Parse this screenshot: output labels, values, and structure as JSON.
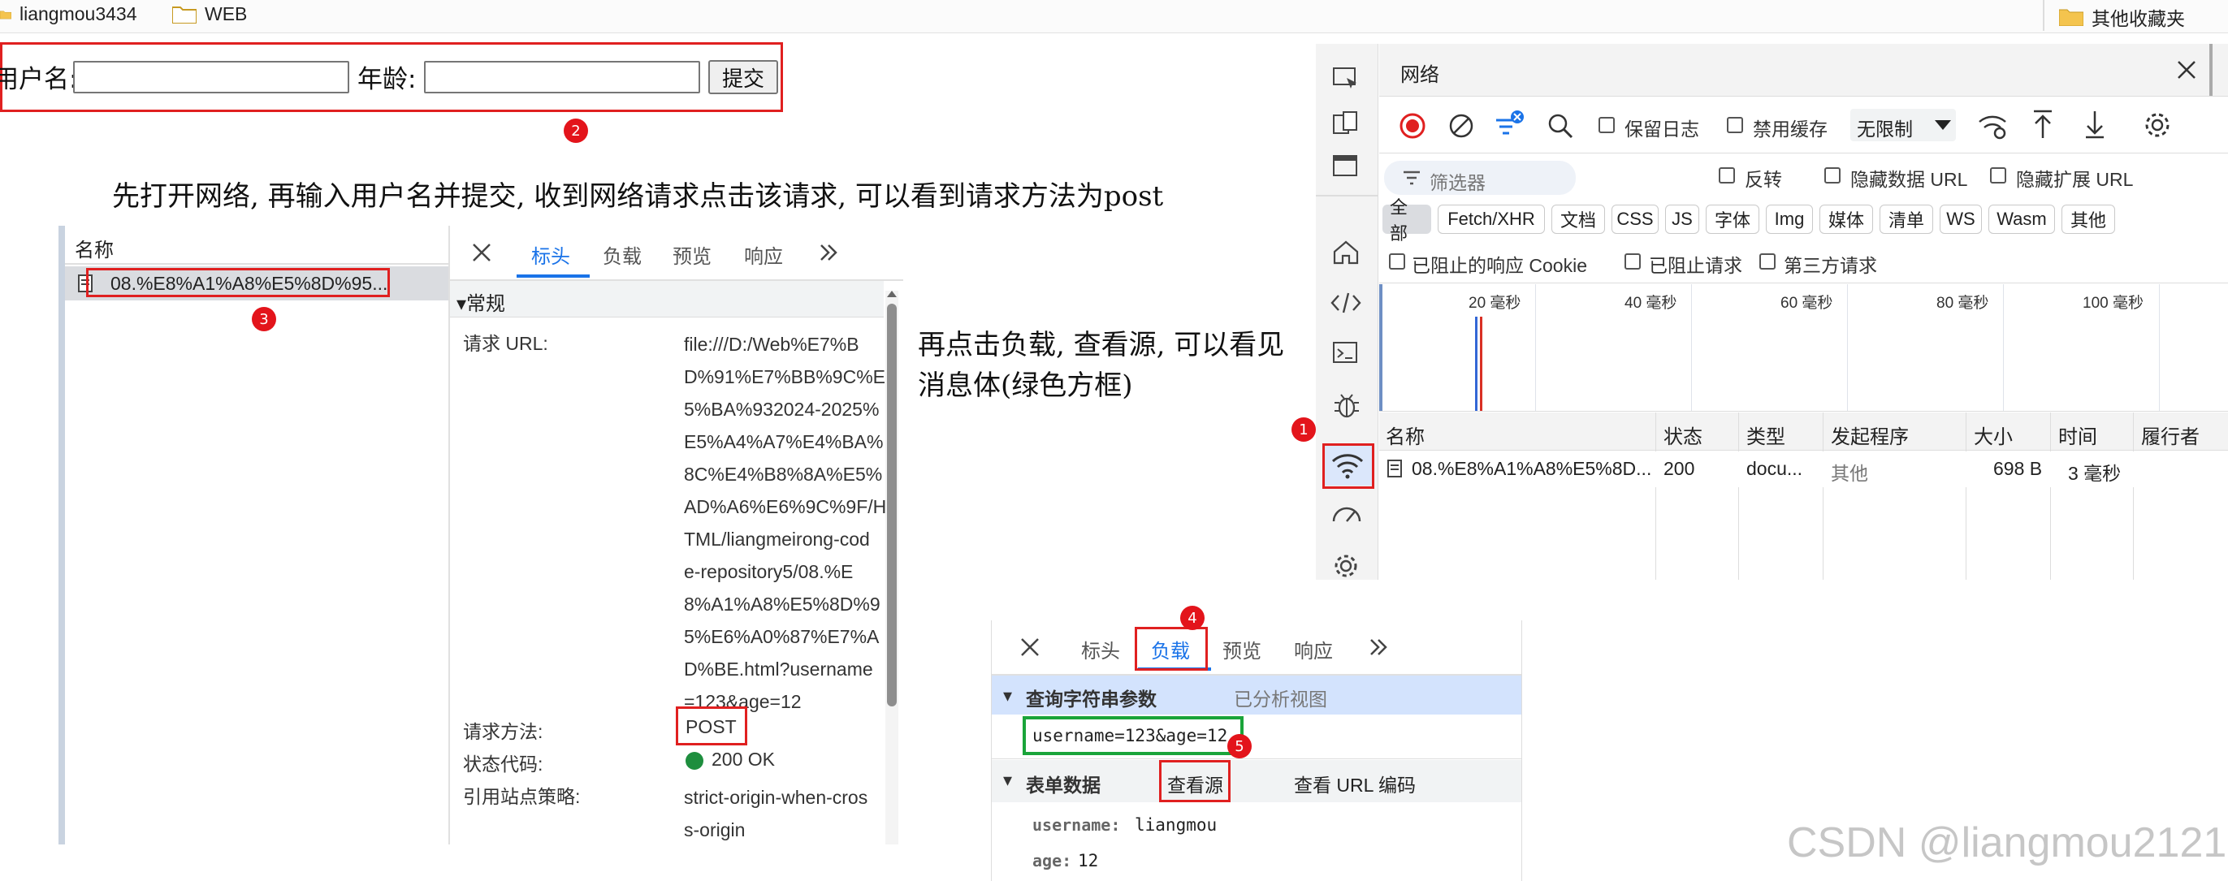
{
  "bookmarks": {
    "items": [
      "liangmou3434",
      "WEB"
    ],
    "other": "其他收藏夹"
  },
  "form": {
    "username_label": "用户名:",
    "age_label": "年龄:",
    "submit": "提交"
  },
  "badges": [
    "1",
    "2",
    "3",
    "4",
    "5"
  ],
  "notes": {
    "step1": "先打开网络, 再输入用户名并提交, 收到网络请求点击该请求, 可以看到请求方法为post",
    "step2_line1": "再点击负载, 查看源, 可以看见",
    "step2_line2": "消息体(绿色方框)"
  },
  "left_panel": {
    "name_header": "名称",
    "request_item": "08.%E8%A1%A8%E5%8D%95...",
    "tabs": [
      "标头",
      "负载",
      "预览",
      "响应"
    ],
    "section": "▾常规",
    "url_key": "请求 URL:",
    "url_lines": [
      "file:///D:/Web%E7%B",
      "D%91%E7%BB%9C%E",
      "5%BA%932024-2025%",
      "E5%A4%A7%E4%BA%",
      "8C%E4%B8%8A%E5%",
      "AD%A6%E6%9C%9F/H",
      "TML/liangmeirong-cod",
      "e-repository5/08.%E",
      "8%A1%A8%E5%8D%9",
      "5%E6%A0%87%E7%A",
      "D%BE.html?username",
      "=123&age=12"
    ],
    "method_key": "请求方法:",
    "method_val": "POST",
    "status_key": "状态代码:",
    "status_val": "200 OK",
    "referrer_key": "引用站点策略:",
    "referrer_lines": [
      "strict-origin-when-cros",
      "s-origin"
    ]
  },
  "network": {
    "title": "网络",
    "preserve_log": "保留日志",
    "disable_cache": "禁用缓存",
    "throttle": "无限制",
    "filter_placeholder": "筛选器",
    "invert": "反转",
    "hide_data_url": "隐藏数据 URL",
    "hide_ext_url": "隐藏扩展 URL",
    "types": [
      "全部",
      "Fetch/XHR",
      "文档",
      "CSS",
      "JS",
      "字体",
      "Img",
      "媒体",
      "清单",
      "WS",
      "Wasm",
      "其他"
    ],
    "blocked_cookies": "已阻止的响应 Cookie",
    "blocked_requests": "已阻止请求",
    "third_party": "第三方请求",
    "timeline": [
      "20 毫秒",
      "40 毫秒",
      "60 毫秒",
      "80 毫秒",
      "100 毫秒"
    ],
    "columns": [
      "名称",
      "状态",
      "类型",
      "发起程序",
      "大小",
      "时间",
      "履行者"
    ],
    "row": {
      "name": "08.%E8%A1%A8%E5%8D...",
      "status": "200",
      "type": "docu...",
      "initiator": "其他",
      "size": "698 B",
      "time": "3 毫秒"
    }
  },
  "payload": {
    "tabs": [
      "标头",
      "负载",
      "预览",
      "响应"
    ],
    "query_header": "查询字符串参数",
    "parsed_view": "已分析视图",
    "query_value": "username=123&age=12",
    "form_header": "表单数据",
    "view_source": "查看源",
    "view_url_encoded": "查看 URL 编码",
    "fields": [
      {
        "key": "username:",
        "value": "liangmou"
      },
      {
        "key": "age:",
        "value": "12"
      }
    ]
  },
  "watermark": "CSDN @liangmou2121",
  "colors": {
    "red": "#e02020",
    "green": "#1aa43a",
    "tab_blue": "#1a73e8",
    "section_bg": "#d3e3fd"
  }
}
